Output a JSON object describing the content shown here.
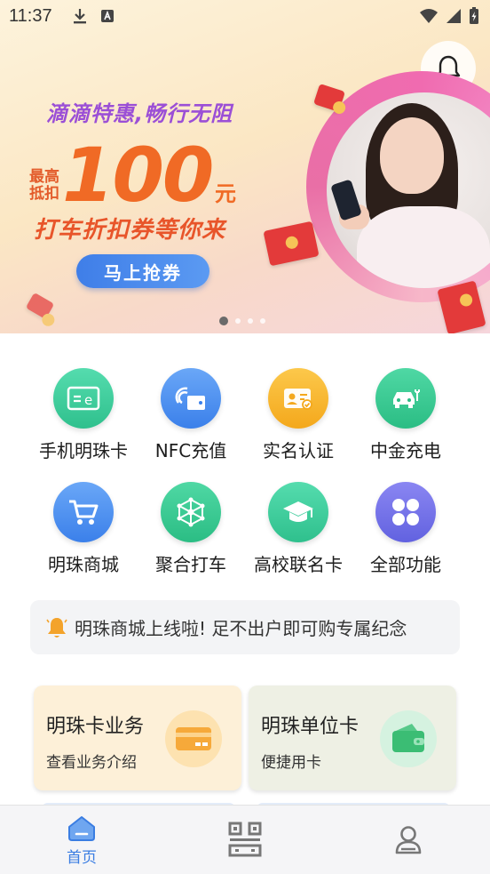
{
  "status_bar": {
    "time": "11:37",
    "icons_left": [
      "download-icon",
      "a-notification-icon"
    ],
    "icons_right": [
      "wifi-icon",
      "signal-icon",
      "battery-charging-icon"
    ]
  },
  "banner": {
    "slogan": "滴滴特惠,畅行无阻",
    "prefix": "最高抵扣",
    "amount": "100",
    "unit": "元",
    "subtitle": "打车折扣券等你来",
    "button_label": "马上抢券",
    "carousel_pages": 4,
    "carousel_active": 1,
    "bell_icon": "bell-icon"
  },
  "grid": {
    "items": [
      {
        "label": "手机明珠卡",
        "icon": "card-icon",
        "color": "#3dcf9b"
      },
      {
        "label": "NFC充值",
        "icon": "nfc-icon",
        "color": "#4a8ff0"
      },
      {
        "label": "实名认证",
        "icon": "id-card-icon",
        "color": "#f7b52a"
      },
      {
        "label": "中金充电",
        "icon": "ev-car-icon",
        "color": "#36c98f"
      },
      {
        "label": "明珠商城",
        "icon": "cart-icon",
        "color": "#4a8ff0"
      },
      {
        "label": "聚合打车",
        "icon": "network-icon",
        "color": "#36c98f"
      },
      {
        "label": "高校联名卡",
        "icon": "graduation-cap-icon",
        "color": "#3dcf9b"
      },
      {
        "label": "全部功能",
        "icon": "apps-icon",
        "color": "#6f6fe8"
      }
    ]
  },
  "notice": {
    "icon": "bell-icon",
    "text": "明珠商城上线啦!  足不出户即可购专属纪念"
  },
  "cards": [
    {
      "title": "明珠卡业务",
      "subtitle": "查看业务介绍",
      "icon": "bank-card-icon",
      "bg": "#fdf0d8"
    },
    {
      "title": "明珠单位卡",
      "subtitle": "便捷用卡",
      "icon": "wallet-icon",
      "bg": "#eef0e4"
    }
  ],
  "bottom_nav": {
    "items": [
      {
        "label": "首页",
        "icon": "home-icon",
        "active": true
      },
      {
        "label": "",
        "icon": "qr-code-icon",
        "active": false
      },
      {
        "label": "",
        "icon": "user-icon",
        "active": false
      }
    ],
    "active_color": "#3a7de2"
  }
}
